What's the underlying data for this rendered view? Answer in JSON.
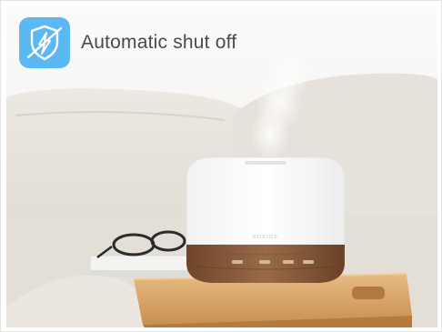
{
  "feature": {
    "label": "Automatic shut off",
    "icon": "shield-bolt-icon",
    "icon_color": "#5bb8f2"
  },
  "product": {
    "brand_mark": "COSIOS"
  },
  "colors": {
    "background": "#f3f1ee",
    "sofa": "#e9e5de",
    "diffuser_top": "#fafafa",
    "diffuser_base": "#8a5a3c",
    "tray": "#d8a86a"
  }
}
